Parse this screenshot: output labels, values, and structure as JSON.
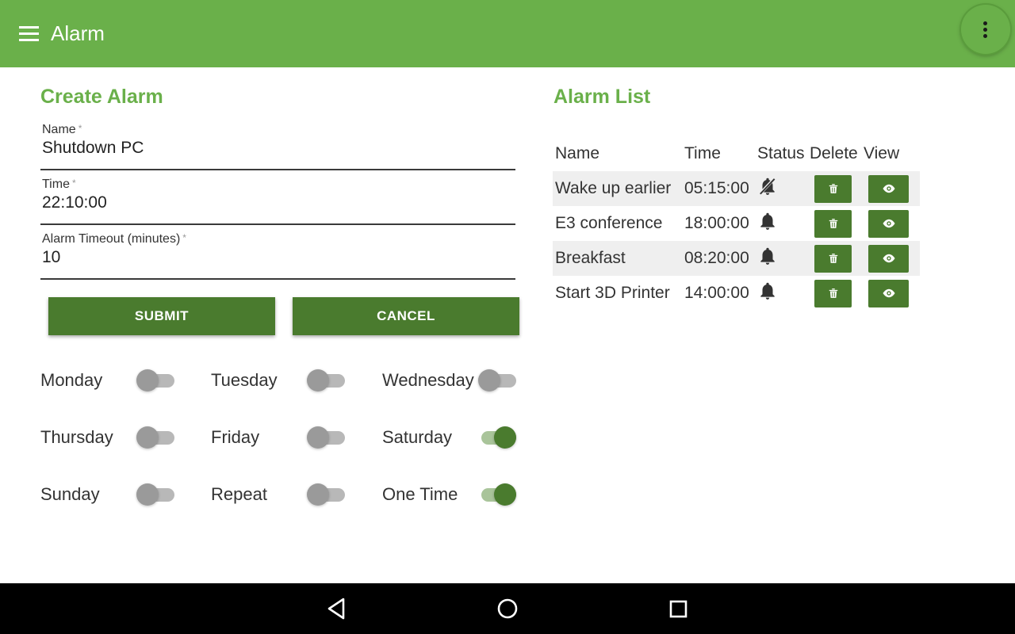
{
  "appbar": {
    "title": "Alarm",
    "menu_icon": "hamburger-menu-icon",
    "overflow_icon": "more-vertical-icon",
    "color": "#6ab04a"
  },
  "create": {
    "title": "Create Alarm",
    "fields": [
      {
        "label": "Name",
        "required": "*",
        "value": "Shutdown PC"
      },
      {
        "label": "Time",
        "required": "*",
        "value": "22:10:00"
      },
      {
        "label": "Alarm Timeout (minutes)",
        "required": "*",
        "value": "10"
      }
    ],
    "submit_label": "SUBMIT",
    "cancel_label": "CANCEL",
    "days": [
      {
        "label": "Monday",
        "on": false
      },
      {
        "label": "Tuesday",
        "on": false
      },
      {
        "label": "Wednesday",
        "on": false
      },
      {
        "label": "Thursday",
        "on": false
      },
      {
        "label": "Friday",
        "on": false
      },
      {
        "label": "Saturday",
        "on": true
      },
      {
        "label": "Sunday",
        "on": false
      },
      {
        "label": "Repeat",
        "on": false
      },
      {
        "label": "One Time",
        "on": true
      }
    ]
  },
  "list": {
    "title": "Alarm List",
    "headers": {
      "name": "Name",
      "time": "Time",
      "status": "Status",
      "delete": "Delete",
      "view": "View"
    },
    "rows": [
      {
        "name": "Wake up earlier",
        "time": "05:15:00",
        "status_icon": "bell-off-icon"
      },
      {
        "name": "E3 conference",
        "time": "18:00:00",
        "status_icon": "bell-icon"
      },
      {
        "name": "Breakfast",
        "time": "08:20:00",
        "status_icon": "bell-icon"
      },
      {
        "name": "Start 3D Printer",
        "time": "14:00:00",
        "status_icon": "bell-icon"
      }
    ]
  },
  "colors": {
    "accent": "#6ab04a",
    "button": "#4a7b2e"
  },
  "navbar": {
    "back_icon": "back-triangle-icon",
    "home_icon": "home-circle-icon",
    "recents_icon": "recents-square-icon"
  }
}
